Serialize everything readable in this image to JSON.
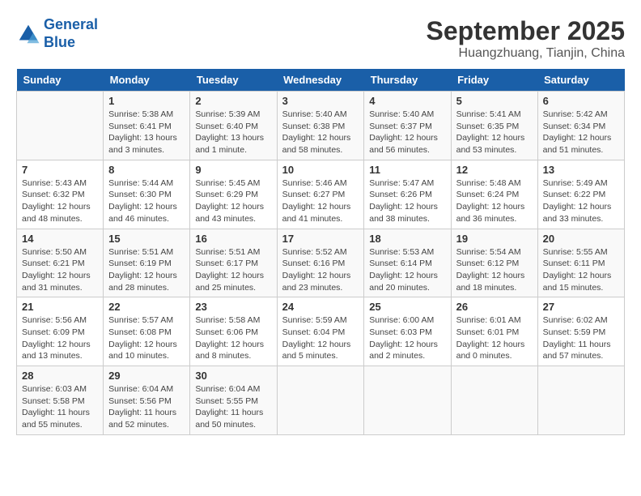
{
  "header": {
    "logo_line1": "General",
    "logo_line2": "Blue",
    "month": "September 2025",
    "location": "Huangzhuang, Tianjin, China"
  },
  "weekdays": [
    "Sunday",
    "Monday",
    "Tuesday",
    "Wednesday",
    "Thursday",
    "Friday",
    "Saturday"
  ],
  "weeks": [
    [
      {
        "day": "",
        "sunrise": "",
        "sunset": "",
        "daylight": ""
      },
      {
        "day": "1",
        "sunrise": "Sunrise: 5:38 AM",
        "sunset": "Sunset: 6:41 PM",
        "daylight": "Daylight: 13 hours and 3 minutes."
      },
      {
        "day": "2",
        "sunrise": "Sunrise: 5:39 AM",
        "sunset": "Sunset: 6:40 PM",
        "daylight": "Daylight: 13 hours and 1 minute."
      },
      {
        "day": "3",
        "sunrise": "Sunrise: 5:40 AM",
        "sunset": "Sunset: 6:38 PM",
        "daylight": "Daylight: 12 hours and 58 minutes."
      },
      {
        "day": "4",
        "sunrise": "Sunrise: 5:40 AM",
        "sunset": "Sunset: 6:37 PM",
        "daylight": "Daylight: 12 hours and 56 minutes."
      },
      {
        "day": "5",
        "sunrise": "Sunrise: 5:41 AM",
        "sunset": "Sunset: 6:35 PM",
        "daylight": "Daylight: 12 hours and 53 minutes."
      },
      {
        "day": "6",
        "sunrise": "Sunrise: 5:42 AM",
        "sunset": "Sunset: 6:34 PM",
        "daylight": "Daylight: 12 hours and 51 minutes."
      }
    ],
    [
      {
        "day": "7",
        "sunrise": "Sunrise: 5:43 AM",
        "sunset": "Sunset: 6:32 PM",
        "daylight": "Daylight: 12 hours and 48 minutes."
      },
      {
        "day": "8",
        "sunrise": "Sunrise: 5:44 AM",
        "sunset": "Sunset: 6:30 PM",
        "daylight": "Daylight: 12 hours and 46 minutes."
      },
      {
        "day": "9",
        "sunrise": "Sunrise: 5:45 AM",
        "sunset": "Sunset: 6:29 PM",
        "daylight": "Daylight: 12 hours and 43 minutes."
      },
      {
        "day": "10",
        "sunrise": "Sunrise: 5:46 AM",
        "sunset": "Sunset: 6:27 PM",
        "daylight": "Daylight: 12 hours and 41 minutes."
      },
      {
        "day": "11",
        "sunrise": "Sunrise: 5:47 AM",
        "sunset": "Sunset: 6:26 PM",
        "daylight": "Daylight: 12 hours and 38 minutes."
      },
      {
        "day": "12",
        "sunrise": "Sunrise: 5:48 AM",
        "sunset": "Sunset: 6:24 PM",
        "daylight": "Daylight: 12 hours and 36 minutes."
      },
      {
        "day": "13",
        "sunrise": "Sunrise: 5:49 AM",
        "sunset": "Sunset: 6:22 PM",
        "daylight": "Daylight: 12 hours and 33 minutes."
      }
    ],
    [
      {
        "day": "14",
        "sunrise": "Sunrise: 5:50 AM",
        "sunset": "Sunset: 6:21 PM",
        "daylight": "Daylight: 12 hours and 31 minutes."
      },
      {
        "day": "15",
        "sunrise": "Sunrise: 5:51 AM",
        "sunset": "Sunset: 6:19 PM",
        "daylight": "Daylight: 12 hours and 28 minutes."
      },
      {
        "day": "16",
        "sunrise": "Sunrise: 5:51 AM",
        "sunset": "Sunset: 6:17 PM",
        "daylight": "Daylight: 12 hours and 25 minutes."
      },
      {
        "day": "17",
        "sunrise": "Sunrise: 5:52 AM",
        "sunset": "Sunset: 6:16 PM",
        "daylight": "Daylight: 12 hours and 23 minutes."
      },
      {
        "day": "18",
        "sunrise": "Sunrise: 5:53 AM",
        "sunset": "Sunset: 6:14 PM",
        "daylight": "Daylight: 12 hours and 20 minutes."
      },
      {
        "day": "19",
        "sunrise": "Sunrise: 5:54 AM",
        "sunset": "Sunset: 6:12 PM",
        "daylight": "Daylight: 12 hours and 18 minutes."
      },
      {
        "day": "20",
        "sunrise": "Sunrise: 5:55 AM",
        "sunset": "Sunset: 6:11 PM",
        "daylight": "Daylight: 12 hours and 15 minutes."
      }
    ],
    [
      {
        "day": "21",
        "sunrise": "Sunrise: 5:56 AM",
        "sunset": "Sunset: 6:09 PM",
        "daylight": "Daylight: 12 hours and 13 minutes."
      },
      {
        "day": "22",
        "sunrise": "Sunrise: 5:57 AM",
        "sunset": "Sunset: 6:08 PM",
        "daylight": "Daylight: 12 hours and 10 minutes."
      },
      {
        "day": "23",
        "sunrise": "Sunrise: 5:58 AM",
        "sunset": "Sunset: 6:06 PM",
        "daylight": "Daylight: 12 hours and 8 minutes."
      },
      {
        "day": "24",
        "sunrise": "Sunrise: 5:59 AM",
        "sunset": "Sunset: 6:04 PM",
        "daylight": "Daylight: 12 hours and 5 minutes."
      },
      {
        "day": "25",
        "sunrise": "Sunrise: 6:00 AM",
        "sunset": "Sunset: 6:03 PM",
        "daylight": "Daylight: 12 hours and 2 minutes."
      },
      {
        "day": "26",
        "sunrise": "Sunrise: 6:01 AM",
        "sunset": "Sunset: 6:01 PM",
        "daylight": "Daylight: 12 hours and 0 minutes."
      },
      {
        "day": "27",
        "sunrise": "Sunrise: 6:02 AM",
        "sunset": "Sunset: 5:59 PM",
        "daylight": "Daylight: 11 hours and 57 minutes."
      }
    ],
    [
      {
        "day": "28",
        "sunrise": "Sunrise: 6:03 AM",
        "sunset": "Sunset: 5:58 PM",
        "daylight": "Daylight: 11 hours and 55 minutes."
      },
      {
        "day": "29",
        "sunrise": "Sunrise: 6:04 AM",
        "sunset": "Sunset: 5:56 PM",
        "daylight": "Daylight: 11 hours and 52 minutes."
      },
      {
        "day": "30",
        "sunrise": "Sunrise: 6:04 AM",
        "sunset": "Sunset: 5:55 PM",
        "daylight": "Daylight: 11 hours and 50 minutes."
      },
      {
        "day": "",
        "sunrise": "",
        "sunset": "",
        "daylight": ""
      },
      {
        "day": "",
        "sunrise": "",
        "sunset": "",
        "daylight": ""
      },
      {
        "day": "",
        "sunrise": "",
        "sunset": "",
        "daylight": ""
      },
      {
        "day": "",
        "sunrise": "",
        "sunset": "",
        "daylight": ""
      }
    ]
  ]
}
